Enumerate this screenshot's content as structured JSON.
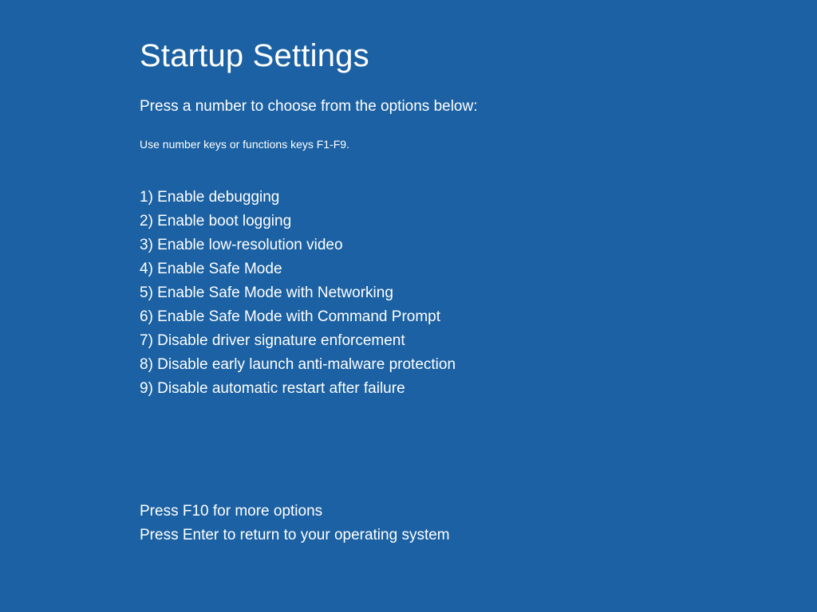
{
  "title": "Startup Settings",
  "instruction": "Press a number to choose from the options below:",
  "hint": "Use number keys or functions keys F1-F9.",
  "options": [
    "1) Enable debugging",
    "2) Enable boot logging",
    "3) Enable low-resolution video",
    "4) Enable Safe Mode",
    "5) Enable Safe Mode with Networking",
    "6) Enable Safe Mode with Command Prompt",
    "7) Disable driver signature enforcement",
    "8) Disable early launch anti-malware protection",
    "9) Disable automatic restart after failure"
  ],
  "footer": {
    "more": "Press F10 for more options",
    "return": "Press Enter to return to your operating system"
  }
}
